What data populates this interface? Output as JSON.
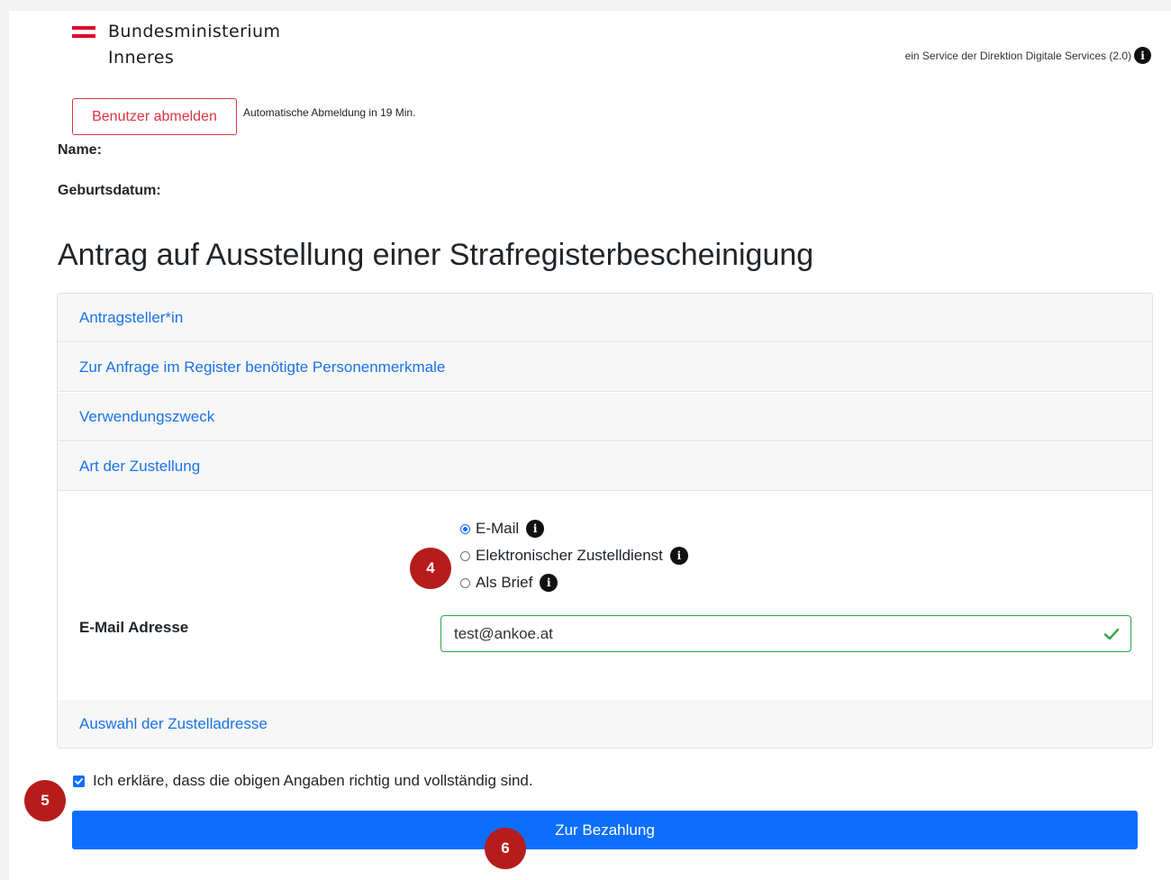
{
  "header": {
    "logo_line1": "Bundesministerium",
    "logo_line2": "Inneres",
    "service_text": "ein Service der Direktion Digitale Services (2.0)",
    "info_icon": "info-icon"
  },
  "session": {
    "logout_button": "Benutzer abmelden",
    "auto_logout_text": "Automatische Abmeldung in 19 Min.",
    "name_label": "Name:",
    "birthdate_label": "Geburtsdatum:"
  },
  "page_title": "Antrag auf Ausstellung einer Strafregisterbescheinigung",
  "accordion": {
    "sections": [
      {
        "label": "Antragsteller*in"
      },
      {
        "label": "Zur Anfrage im Register benötigte Personenmerkmale"
      },
      {
        "label": "Verwendungszweck"
      },
      {
        "label": "Art der Zustellung"
      },
      {
        "label": "Auswahl der Zustelladresse"
      }
    ],
    "delivery": {
      "options": [
        {
          "label": "E-Mail",
          "selected": true
        },
        {
          "label": "Elektronischer Zustelldienst",
          "selected": false
        },
        {
          "label": "Als Brief",
          "selected": false
        }
      ],
      "email_label": "E-Mail Adresse",
      "email_value": "test@ankoe.at"
    }
  },
  "consent": {
    "label": "Ich erkläre, dass die obigen Angaben richtig und vollständig sind.",
    "checked": true
  },
  "submit_button": "Zur Bezahlung",
  "markers": [
    "4",
    "5",
    "6"
  ],
  "colors": {
    "primary": "#0d6efd",
    "danger": "#dc3545",
    "link": "#1a73e8",
    "success": "#28a745",
    "marker": "#b71c1c",
    "flag_red": "#e4002b"
  }
}
